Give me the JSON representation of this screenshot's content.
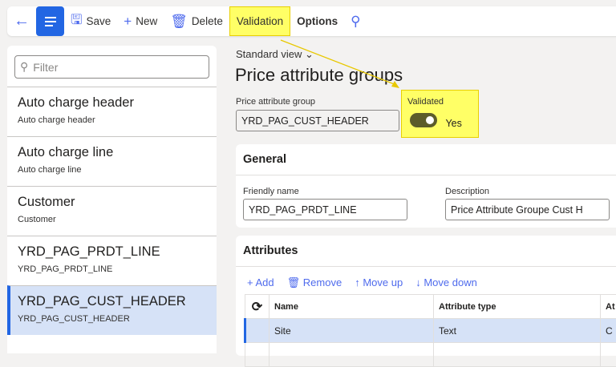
{
  "toolbar": {
    "save": "Save",
    "new": "New",
    "delete": "Delete",
    "validation": "Validation",
    "options": "Options"
  },
  "filter": {
    "placeholder": "Filter"
  },
  "list": [
    {
      "title": "Auto charge header",
      "sub": "Auto charge header"
    },
    {
      "title": "Auto charge line",
      "sub": "Auto charge line"
    },
    {
      "title": "Customer",
      "sub": "Customer"
    },
    {
      "title": "YRD_PAG_PRDT_LINE",
      "sub": "YRD_PAG_PRDT_LINE"
    },
    {
      "title": "YRD_PAG_CUST_HEADER",
      "sub": "YRD_PAG_CUST_HEADER"
    }
  ],
  "main": {
    "view": "Standard view",
    "title": "Price attribute groups",
    "pag_label": "Price attribute group",
    "pag_value": "YRD_PAG_CUST_HEADER",
    "validated_label": "Validated",
    "validated_value": "Yes",
    "general": {
      "title": "General",
      "friendly_label": "Friendly name",
      "friendly_value": "YRD_PAG_PRDT_LINE",
      "desc_label": "Description",
      "desc_value": "Price Attribute Groupe Cust H"
    },
    "attributes": {
      "title": "Attributes",
      "add": "Add",
      "remove": "Remove",
      "up": "Move up",
      "down": "Move down",
      "columns": [
        "Name",
        "Attribute type",
        "At"
      ],
      "rows": [
        [
          "Site",
          "Text",
          "C"
        ]
      ]
    }
  }
}
